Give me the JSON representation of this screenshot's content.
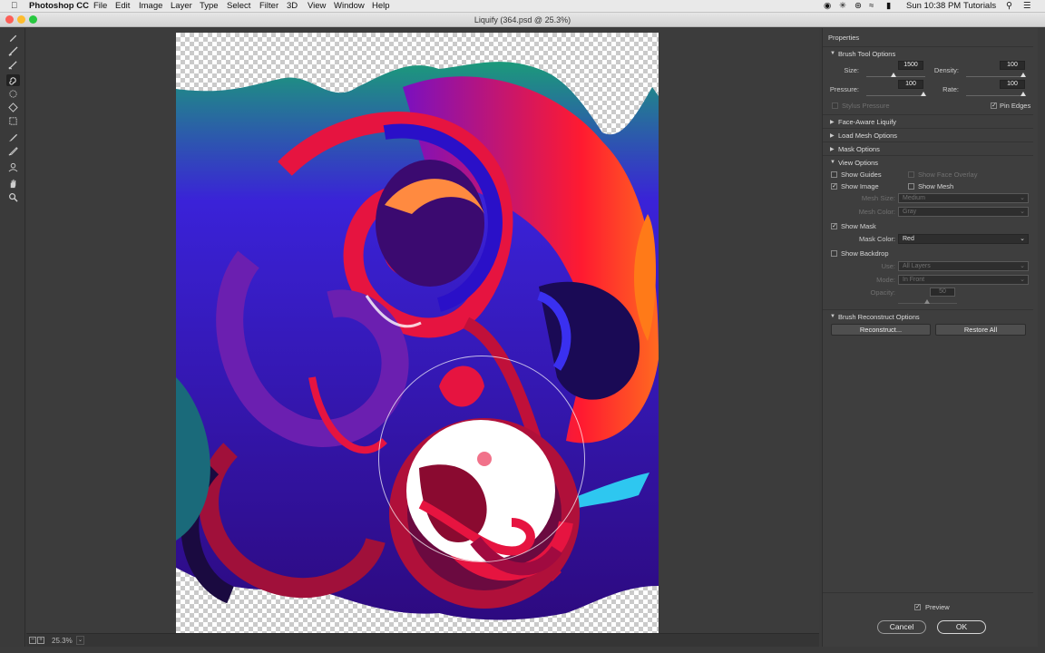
{
  "menubar": {
    "app_name": "Photoshop CC",
    "items": [
      "File",
      "Edit",
      "Image",
      "Layer",
      "Type",
      "Select",
      "Filter",
      "3D",
      "View",
      "Window",
      "Help"
    ],
    "clock": "Sun 10:38 PM",
    "user": "Tutorials"
  },
  "window": {
    "title": "Liquify (364.psd @ 25.3%)"
  },
  "status": {
    "zoom": "25.3%"
  },
  "panel": {
    "title": "Properties",
    "brush_tool_options": {
      "label": "Brush Tool Options",
      "size_label": "Size:",
      "size": "1500",
      "density_label": "Density:",
      "density": "100",
      "pressure_label": "Pressure:",
      "pressure": "100",
      "rate_label": "Rate:",
      "rate": "100",
      "stylus_label": "Stylus Pressure",
      "pin_edges_label": "Pin Edges"
    },
    "face_aware": "Face-Aware Liquify",
    "load_mesh": "Load Mesh Options",
    "mask_options": "Mask Options",
    "view_options": {
      "label": "View Options",
      "show_guides": "Show Guides",
      "show_face_overlay": "Show Face Overlay",
      "show_image": "Show Image",
      "show_mesh": "Show Mesh",
      "mesh_size_label": "Mesh Size:",
      "mesh_size": "Medium",
      "mesh_color_label": "Mesh Color:",
      "mesh_color": "Gray",
      "show_mask": "Show Mask",
      "mask_color_label": "Mask Color:",
      "mask_color": "Red",
      "show_backdrop": "Show Backdrop",
      "use_label": "Use:",
      "use": "All Layers",
      "mode_label": "Mode:",
      "mode": "In Front",
      "opacity_label": "Opacity:",
      "opacity": "50"
    },
    "brush_reconstruct": {
      "label": "Brush Reconstruct Options",
      "reconstruct_btn": "Reconstruct...",
      "restore_btn": "Restore All"
    },
    "preview_label": "Preview",
    "cancel": "Cancel",
    "ok": "OK"
  },
  "tools": [
    "forward-warp-icon",
    "reconstruct-icon",
    "smooth-icon",
    "twirl-icon",
    "pucker-icon",
    "bloat-icon",
    "push-left-icon",
    "freeze-mask-icon",
    "thaw-mask-icon",
    "face-tool-icon",
    "hand-icon",
    "zoom-icon"
  ],
  "colors": {
    "accent_red": "#e8143c",
    "deep_blue": "#2a10c8",
    "purple": "#6b1fb0",
    "cyan": "#2ec7f0"
  }
}
